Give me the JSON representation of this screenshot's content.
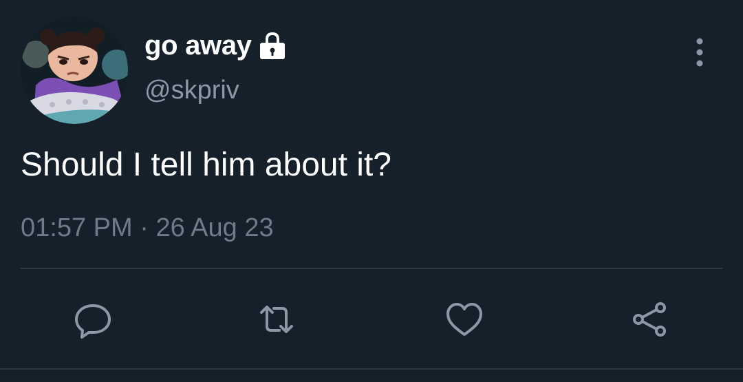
{
  "tweet": {
    "author": {
      "display_name": "go away",
      "handle": "@skpriv",
      "protected_icon": "lock-icon",
      "avatar_icon": "profile-avatar"
    },
    "text": "Should I tell him about it?",
    "time": "01:57 PM",
    "separator": "·",
    "date": "26 Aug 23",
    "menu_icon": "more-vertical-icon",
    "actions": [
      {
        "name": "reply",
        "icon": "reply-icon"
      },
      {
        "name": "retweet",
        "icon": "retweet-icon"
      },
      {
        "name": "like",
        "icon": "heart-icon"
      },
      {
        "name": "share",
        "icon": "share-icon"
      }
    ]
  },
  "colors": {
    "background": "#15202b",
    "primary_text": "#ffffff",
    "secondary_text": "#8b98a5",
    "icon": "#8b98a5",
    "divider": "#2f3b47"
  }
}
